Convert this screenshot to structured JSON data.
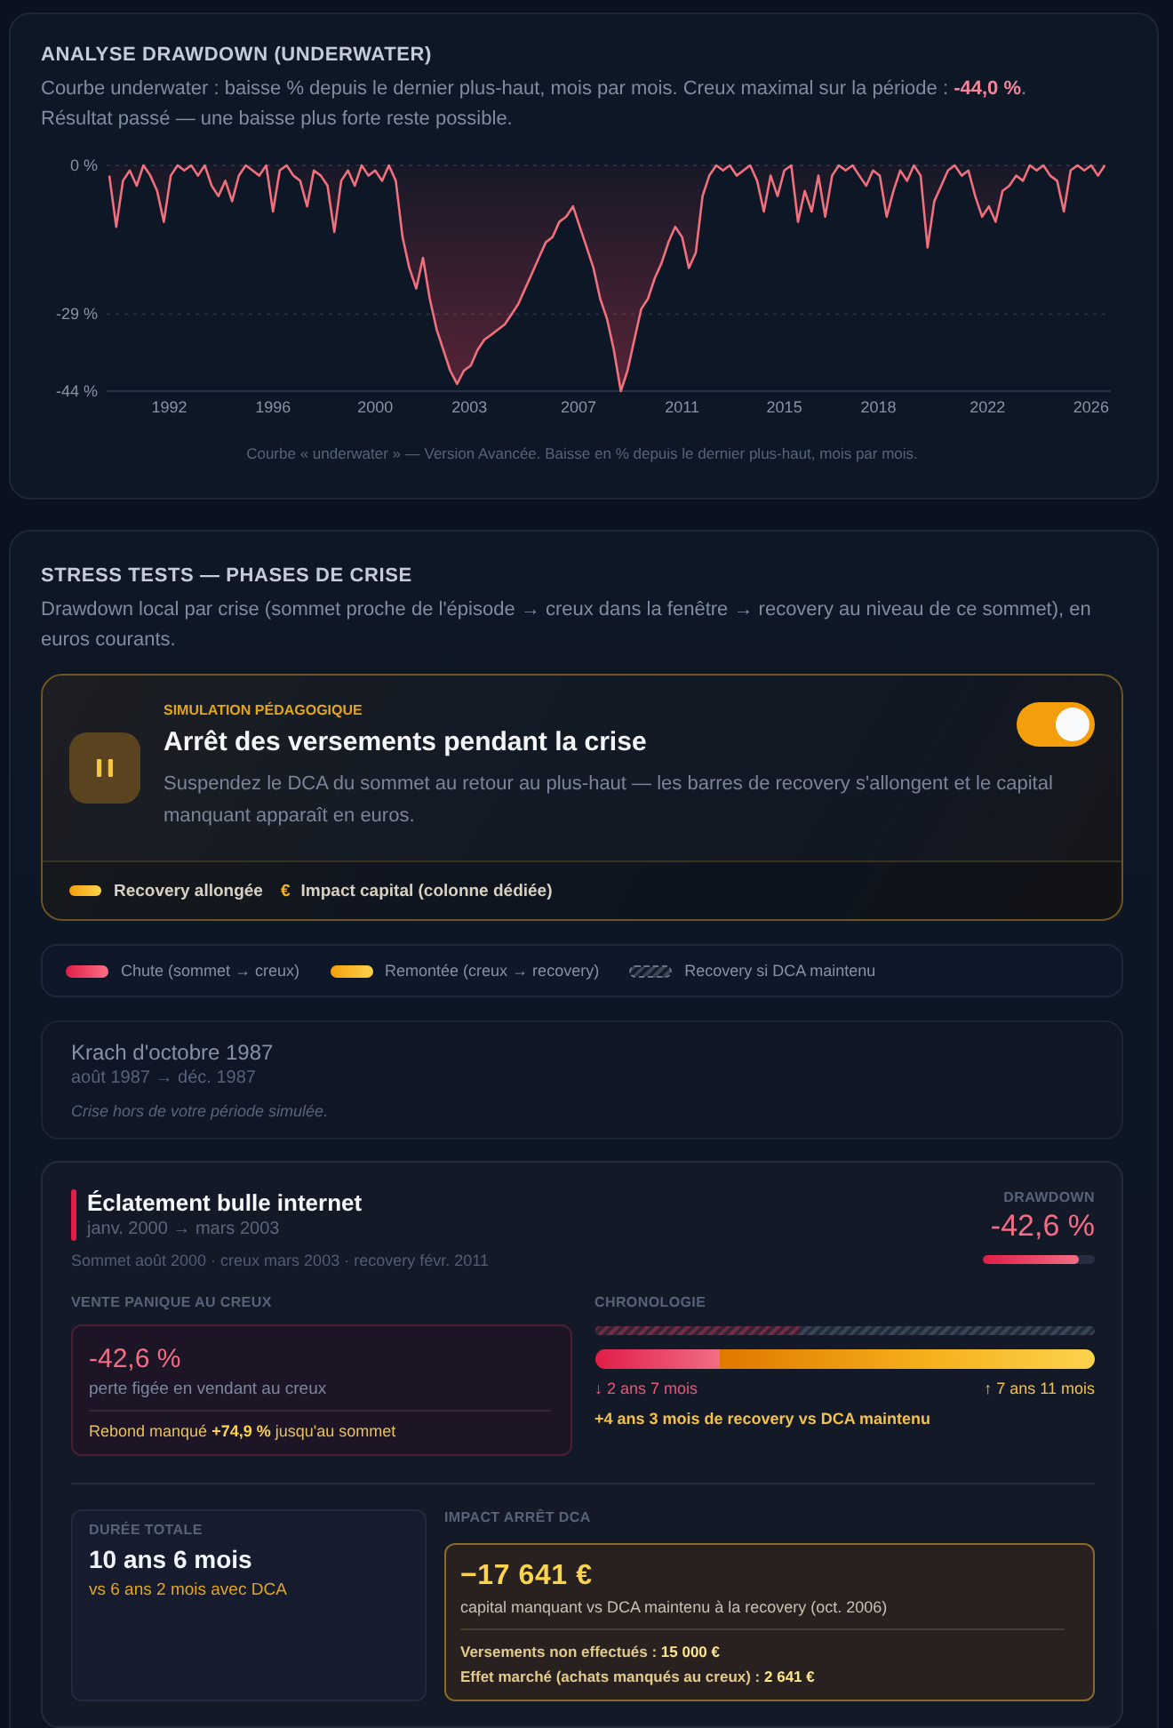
{
  "drawdown": {
    "title": "ANALYSE DRAWDOWN (UNDERWATER)",
    "description": "Courbe underwater : baisse % depuis le dernier plus-haut, mois par mois. Creux maximal sur la période : **-44,0 %**.",
    "note": "Résultat passé — une baisse plus forte reste possible.",
    "chart_data": {
      "type": "area",
      "x": [
        1990.25,
        1990.5,
        1990.75,
        1991,
        1991.25,
        1991.5,
        1991.75,
        1992,
        1992.25,
        1992.5,
        1992.75,
        1993,
        1993.25,
        1993.5,
        1993.75,
        1994,
        1994.25,
        1994.5,
        1994.75,
        1995,
        1995.25,
        1995.5,
        1995.75,
        1996,
        1996.25,
        1996.5,
        1996.75,
        1997,
        1997.25,
        1997.5,
        1997.75,
        1998,
        1998.25,
        1998.5,
        1998.75,
        1999,
        1999.25,
        1999.5,
        1999.75,
        2000,
        2000.25,
        2000.5,
        2000.75,
        2001,
        2001.25,
        2001.5,
        2001.75,
        2002,
        2002.25,
        2002.5,
        2002.75,
        2003,
        2003.25,
        2003.5,
        2003.75,
        2004,
        2004.25,
        2004.5,
        2004.75,
        2005,
        2005.25,
        2005.5,
        2005.75,
        2006,
        2006.25,
        2006.5,
        2006.75,
        2007,
        2007.25,
        2007.5,
        2007.75,
        2008,
        2008.25,
        2008.5,
        2008.75,
        2009,
        2009.25,
        2009.5,
        2009.75,
        2010,
        2010.25,
        2010.5,
        2010.75,
        2011,
        2011.25,
        2011.5,
        2011.75,
        2012,
        2012.25,
        2012.5,
        2012.75,
        2013,
        2013.25,
        2013.5,
        2013.75,
        2014,
        2014.25,
        2014.5,
        2014.75,
        2015,
        2015.25,
        2015.5,
        2015.75,
        2016,
        2016.25,
        2016.5,
        2016.75,
        2017,
        2017.25,
        2017.5,
        2017.75,
        2018,
        2018.25,
        2018.5,
        2018.75,
        2019,
        2019.25,
        2019.5,
        2019.75,
        2020,
        2020.25,
        2020.5,
        2020.75,
        2021,
        2021.25,
        2021.5,
        2021.75,
        2022,
        2022.25,
        2022.5,
        2022.75,
        2023,
        2023.25,
        2023.5,
        2023.75,
        2024,
        2024.25,
        2024.5,
        2024.75,
        2025,
        2025.25,
        2025.5,
        2025.75,
        2026,
        2026.25,
        2026.5,
        2026.75
      ],
      "series": [
        {
          "color": "#f0707e",
          "values": [
            -2,
            -12,
            -3,
            -1,
            -4,
            0,
            -2,
            -5,
            -11,
            -2,
            0,
            -1,
            0,
            -2,
            0,
            -4,
            -6,
            -3,
            -7,
            -2,
            0,
            -1,
            -2,
            0,
            -9,
            -1,
            0,
            -2,
            -3,
            -8,
            -1,
            -2,
            -4,
            -13,
            -3,
            -1,
            -4,
            0,
            -2,
            -1,
            -3,
            0,
            -3,
            -14,
            -20,
            -24,
            -18,
            -26,
            -32,
            -36,
            -40,
            -42.6,
            -40,
            -39,
            -36,
            -34,
            -33,
            -32,
            -31,
            -29,
            -27,
            -24,
            -21,
            -18,
            -15,
            -14,
            -11,
            -10,
            -8,
            -12,
            -16,
            -20,
            -26,
            -30,
            -36,
            -44,
            -40,
            -34,
            -28,
            -26,
            -22,
            -19,
            -15,
            -12,
            -14,
            -20,
            -17,
            -6,
            -2,
            0,
            -1,
            0,
            -2,
            -1,
            0,
            -3,
            -9,
            -2,
            -6,
            -1,
            0,
            -11,
            -5,
            -9,
            -2,
            -10,
            -2,
            0,
            -1,
            0,
            -2,
            -4,
            -1,
            -2,
            -10,
            -5,
            -1,
            -3,
            0,
            -2,
            -16,
            -7,
            -4,
            -1,
            0,
            -2,
            -1,
            -6,
            -10,
            -8,
            -11,
            -5,
            -4,
            -2,
            -3,
            0,
            -1,
            0,
            -2,
            -3,
            -9,
            -1,
            0,
            -1,
            0,
            -2,
            0
          ]
        }
      ],
      "xlim": [
        1990.15,
        2026.97
      ],
      "ylim": [
        -44,
        0
      ],
      "xticks": [
        {
          "value": 1992.45,
          "label": "1992"
        },
        {
          "value": 1996.25,
          "label": "1996"
        },
        {
          "value": 2000,
          "label": "2000"
        },
        {
          "value": 2003.45,
          "label": "2003"
        },
        {
          "value": 2007.45,
          "label": "2007"
        },
        {
          "value": 2011.25,
          "label": "2011"
        },
        {
          "value": 2015,
          "label": "2015"
        },
        {
          "value": 2018.45,
          "label": "2018"
        },
        {
          "value": 2022.45,
          "label": "2022"
        },
        {
          "value": 2026.25,
          "label": "2026"
        }
      ],
      "yticks": [
        {
          "value": 0,
          "label": "0 %"
        },
        {
          "value": -29,
          "label": "-29 %"
        },
        {
          "value": -44,
          "label": "-44 %"
        }
      ]
    },
    "caption": "Courbe « underwater » — Version Avancée. Baisse en % depuis le dernier plus-haut, mois par mois."
  },
  "stress": {
    "title": "STRESS TESTS — PHASES DE CRISE",
    "description": "Drawdown local par crise (sommet proche de l'épisode → creux dans la fenêtre → recovery au niveau de ce sommet), en euros courants.",
    "simulation": {
      "eyebrow": "SIMULATION PÉDAGOGIQUE",
      "title": "Arrêt des versements pendant la crise",
      "description": "Suspendez le DCA du sommet au retour au plus-haut — les barres de recovery s'allongent et le capital manquant apparaît en euros.",
      "on": true,
      "footer": [
        {
          "kind": "bar",
          "label": "Recovery allongée"
        },
        {
          "kind": "symbol",
          "symbol": "€",
          "label": "Impact capital (colonne dédiée)"
        }
      ]
    },
    "legend": [
      {
        "kind": "fall",
        "label": "Chute (sommet → creux)"
      },
      {
        "kind": "rise",
        "label": "Remontée (creux → recovery)"
      },
      {
        "kind": "dca",
        "label": "Recovery si DCA maintenu"
      }
    ],
    "crises": [
      {
        "kind": "outside",
        "name": "Krach d'octobre 1987",
        "period": "août 1987 → déc. 1987",
        "note": "Crise hors de votre période simulée."
      },
      {
        "kind": "detailed",
        "name": "Éclatement bulle internet",
        "period": "janv. 2000 → mars 2003",
        "dates": "Sommet août 2000 · creux mars 2003 · recovery févr. 2011",
        "drawdown": {
          "label": "DRAWDOWN",
          "value": "-42,6 %",
          "level": 0.85
        },
        "panic": {
          "label": "VENTE PANIQUE AU CREUX",
          "value": "-42,6 %",
          "caption": "perte figée en vendant au creux",
          "rebound": "Rebond manqué **+74,9 %** jusqu'au sommet"
        },
        "chronology": {
          "label": "CHRONOLOGIE",
          "dca_bar": {
            "level": 0.41
          },
          "segments": [
            {
              "kind": "fall",
              "level": 0.25
            },
            {
              "kind": "rise",
              "level": 0.75
            }
          ],
          "fall_text": "↓ 2 ans 7 mois",
          "rise_text": "↑ 7 ans 11 mois",
          "extra": "+4 ans 3 mois de recovery vs DCA maintenu"
        },
        "duration": {
          "label": "DURÉE TOTALE",
          "value": "10 ans 6 mois",
          "compare": "vs 6 ans 2 mois avec DCA"
        },
        "impact": {
          "label": "IMPACT ARRÊT DCA",
          "value": "−17 641 €",
          "caption": "capital manquant vs DCA maintenu à la recovery (oct. 2006)",
          "lines": [
            "Versements non effectués : **15 000 €**",
            "Effet marché (achats manqués au creux) : **2 641 €**"
          ]
        }
      }
    ]
  }
}
